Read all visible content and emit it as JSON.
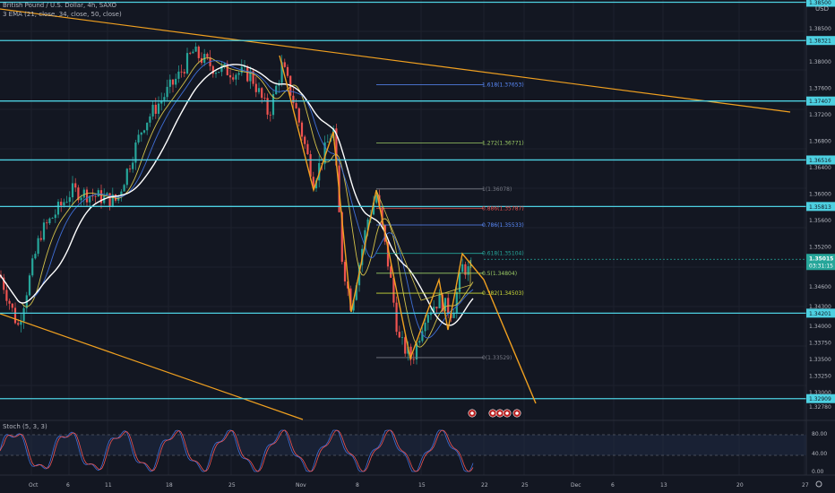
{
  "header": {
    "title": "British Pound / U.S. Dollar, 4h, SAXO",
    "indicator": "3 EMA (21, close, 34, close, 50, close)",
    "currency": "USD"
  },
  "stoch_label": "Stoch (5, 3, 3)",
  "colors": {
    "background": "#131722",
    "level_line": "#4dd0e1",
    "trendline": "#f0a020",
    "ema_white": "#ffffff",
    "ema_blue": "#3f6fd8",
    "ema_yellow": "#d4c24a",
    "candle_up": "#26a69a",
    "candle_down": "#ef5350",
    "pattern": "#f0a020",
    "stoch_k": "#3f6fd8",
    "stoch_d": "#ef5350"
  },
  "price_axis": {
    "labels": [
      "1.38500",
      "1.38000",
      "1.37600",
      "1.37200",
      "1.36800",
      "1.36400",
      "1.36000",
      "1.35600",
      "1.35200",
      "1.34600",
      "1.34300",
      "1.34000",
      "1.33750",
      "1.33500",
      "1.33250",
      "1.33000",
      "1.32780"
    ]
  },
  "levels": [
    {
      "label": "1.38500",
      "price": 1.389
    },
    {
      "label": "1.38321",
      "price": 1.38321
    },
    {
      "label": "1.37407",
      "price": 1.37407
    },
    {
      "label": "1.36516",
      "price": 1.36516
    },
    {
      "label": "1.35813",
      "price": 1.35813
    },
    {
      "label": "1.34201",
      "price": 1.34201
    },
    {
      "label": "1.32909",
      "price": 1.32909
    }
  ],
  "current_price": {
    "price": "1.35015",
    "countdown": "03:31:15"
  },
  "fib_levels": [
    {
      "label": "1.618(1.37653)",
      "price": 1.37653,
      "color": "#5b8cff"
    },
    {
      "label": "1.272(1.36771)",
      "price": 1.36771,
      "color": "#9ccc65"
    },
    {
      "label": "1(1.36078)",
      "price": 1.36078,
      "color": "#787b86"
    },
    {
      "label": "0.886(1.35787)",
      "price": 1.35787,
      "color": "#ef5350"
    },
    {
      "label": "0.786(1.35533)",
      "price": 1.35533,
      "color": "#5b8cff"
    },
    {
      "label": "0.618(1.35104)",
      "price": 1.35104,
      "color": "#26a69a"
    },
    {
      "label": "0.5(1.34804)",
      "price": 1.34804,
      "color": "#9ccc65"
    },
    {
      "label": "0.382(1.34503)",
      "price": 1.34503,
      "color": "#cddc39"
    },
    {
      "label": "0(1.33529)",
      "price": 1.33529,
      "color": "#787b86"
    }
  ],
  "time_axis": [
    "Oct",
    "6",
    "11",
    "18",
    "25",
    "Nov",
    "8",
    "15",
    "22",
    "25",
    "Dec",
    "6",
    "13",
    "20",
    "27"
  ],
  "stoch_axis": [
    "80.00",
    "40.00",
    "0.00"
  ]
}
